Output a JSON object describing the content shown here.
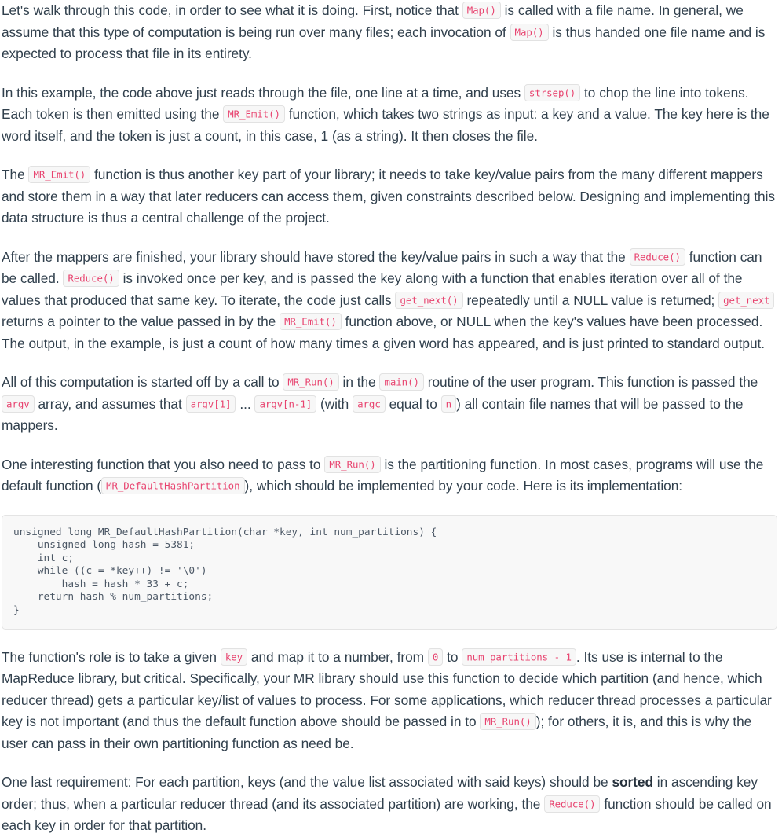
{
  "document": {
    "body_text_color": "#31404d",
    "inline_code_color": "#e8436f",
    "inline_code_bg": "#f7f7f7",
    "code_block_bg": "#f8f8f8",
    "code_block_border": "#e4e4e4"
  },
  "paragraphs": {
    "p1": {
      "s1": "Let's walk through this code, in order to see what it is doing. First, notice that ",
      "c1": "Map()",
      "s2": " is called with a file name. In general, we assume that this type of computation is being run over many files; each invocation of ",
      "c2": "Map()",
      "s3": " is thus handed one file name and is expected to process that file in its entirety."
    },
    "p2": {
      "s1": "In this example, the code above just reads through the file, one line at a time, and uses ",
      "c1": "strsep()",
      "s2": " to chop the line into tokens. Each token is then emitted using the ",
      "c2": "MR_Emit()",
      "s3": " function, which takes two strings as input: a key and a value. The key here is the word itself, and the token is just a count, in this case, 1 (as a string). It then closes the file."
    },
    "p3": {
      "s1": "The ",
      "c1": "MR_Emit()",
      "s2": " function is thus another key part of your library; it needs to take key/value pairs from the many different mappers and store them in a way that later reducers can access them, given constraints described below. Designing and implementing this data structure is thus a central challenge of the project."
    },
    "p4": {
      "s1": "After the mappers are finished, your library should have stored the key/value pairs in such a way that the ",
      "c1": "Reduce()",
      "s2": " function can be called. ",
      "c2": "Reduce()",
      "s3": " is invoked once per key, and is passed the key along with a function that enables iteration over all of the values that produced that same key. To iterate, the code just calls ",
      "c3": "get_next()",
      "s4": " repeatedly until a NULL value is returned; ",
      "c4": "get_next",
      "s5": " returns a pointer to the value passed in by the ",
      "c5": "MR_Emit()",
      "s6": " function above, or NULL when the key's values have been processed. The output, in the example, is just a count of how many times a given word has appeared, and is just printed to standard output."
    },
    "p5": {
      "s1": "All of this computation is started off by a call to ",
      "c1": "MR_Run()",
      "s2": " in the ",
      "c2": "main()",
      "s3": " routine of the user program. This function is passed the ",
      "c3": "argv",
      "s4": " array, and assumes that ",
      "c4": "argv[1]",
      "s5": " ... ",
      "c5": "argv[n-1]",
      "s6": " (with ",
      "c6": "argc",
      "s7": " equal to ",
      "c7": "n",
      "s8": ") all contain file names that will be passed to the mappers."
    },
    "p6": {
      "s1": "One interesting function that you also need to pass to ",
      "c1": "MR_Run()",
      "s2": " is the partitioning function. In most cases, programs will use the default function (",
      "c2": "MR_DefaultHashPartition",
      "s3": "), which should be implemented by your code. Here is its implementation:"
    },
    "p7": {
      "s1": "The function's role is to take a given ",
      "c1": "key",
      "s2": " and map it to a number, from ",
      "c2": "0",
      "s3": " to ",
      "c3": "num_partitions - 1",
      "s4": ". Its use is internal to the MapReduce library, but critical. Specifically, your MR library should use this function to decide which partition (and hence, which reducer thread) gets a particular key/list of values to process. For some applications, which reducer thread processes a particular key is not important (and thus the default function above should be passed in to ",
      "c4": "MR_Run()",
      "s5": "); for others, it is, and this is why the user can pass in their own partitioning function as need be."
    },
    "p8": {
      "s1": "One last requirement: For each partition, keys (and the value list associated with said keys) should be ",
      "b1": "sorted",
      "s2": " in ascending key order; thus, when a particular reducer thread (and its associated partition) are working, the ",
      "c1": "Reduce()",
      "s3": " function should be called on each key in order for that partition."
    }
  },
  "code_block": {
    "language": "c",
    "content": "unsigned long MR_DefaultHashPartition(char *key, int num_partitions) {\n    unsigned long hash = 5381;\n    int c;\n    while ((c = *key++) != '\\0')\n        hash = hash * 33 + c;\n    return hash % num_partitions;\n}"
  }
}
